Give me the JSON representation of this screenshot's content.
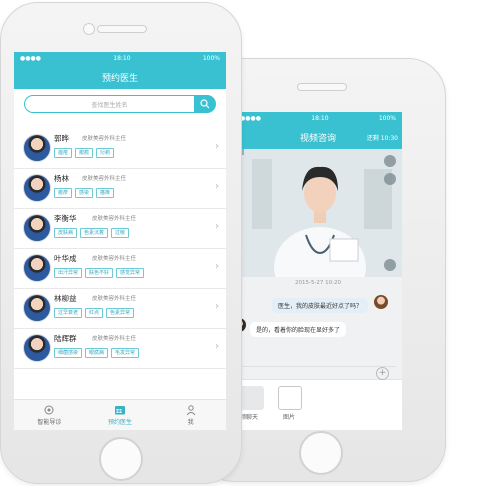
{
  "colors": {
    "accent": "#39c1d2",
    "tag_text": "#39a9c0"
  },
  "front": {
    "status": {
      "time": "18:10",
      "battery": "100%"
    },
    "title": "预约医生",
    "search": {
      "placeholder": "查找医生姓名"
    },
    "doctors": [
      {
        "name": "郭晔",
        "title": "皮肤美容外科主任",
        "tags": [
          "痤疮",
          "瘢痕",
          "衍剃"
        ]
      },
      {
        "name": "杨林",
        "title": "皮肤美容外科主任",
        "tags": [
          "瘢疹",
          "感染",
          "瘙痒"
        ]
      },
      {
        "name": "李衡华",
        "title": "皮肤美容外科主任",
        "tags": [
          "皮肤病",
          "色素沉着",
          "过敏"
        ]
      },
      {
        "name": "叶华成",
        "title": "皮肤美容外科主任",
        "tags": [
          "出汗异常",
          "肤色不好",
          "感觉异常"
        ]
      },
      {
        "name": "林柳益",
        "title": "皮肤美容外科主任",
        "tags": [
          "过早衰老",
          "红点",
          "色素异常"
        ]
      },
      {
        "name": "陆辉群",
        "title": "皮肤美容外科主任",
        "tags": [
          "细菌感染",
          "眼腐病",
          "毛发异常"
        ]
      }
    ],
    "tabs": [
      {
        "label": "智能导诊",
        "icon": "smart-guide-icon"
      },
      {
        "label": "预约医生",
        "icon": "calendar-icon"
      },
      {
        "label": "我",
        "icon": "person-icon"
      }
    ]
  },
  "back": {
    "status": {
      "time": "18:10",
      "battery": "100%"
    },
    "title": "视频咨询",
    "timer": "还剩 10:30",
    "timestamp": "2015-5-27 10:20",
    "messages": [
      {
        "side": "right",
        "text": "医生，我的皮肤最近好点了吗？"
      },
      {
        "side": "left",
        "text": "是的，看着你的脸现在显好多了"
      }
    ],
    "bottom": [
      {
        "label": "视频聊天",
        "icon": "video-icon"
      },
      {
        "label": "图片",
        "icon": "image-icon"
      }
    ]
  }
}
